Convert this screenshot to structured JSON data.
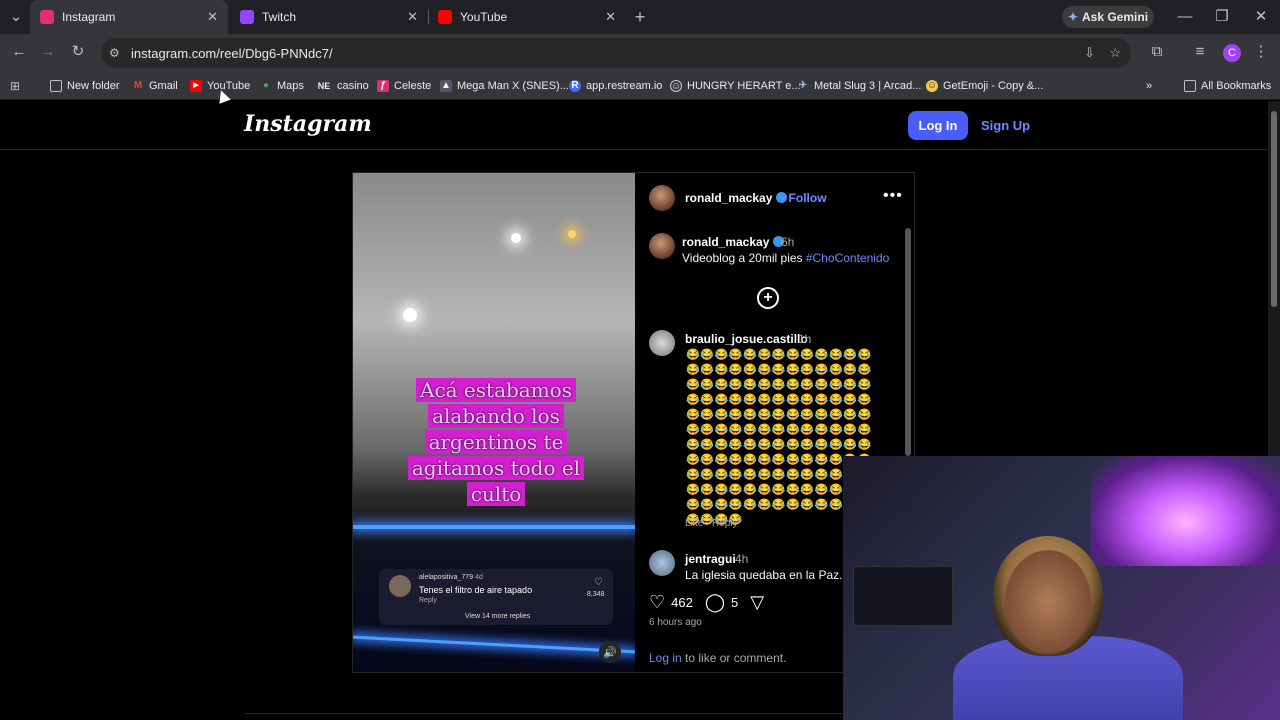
{
  "browser": {
    "tabs": [
      {
        "title": "Instagram",
        "active": true,
        "icon": "instagram-icon",
        "color": "#e1306c"
      },
      {
        "title": "Twitch",
        "active": false,
        "icon": "twitch-icon",
        "color": "#9146ff"
      },
      {
        "title": "YouTube",
        "active": false,
        "icon": "youtube-icon",
        "color": "#ff0000"
      }
    ],
    "ask_gemini": "Ask Gemini",
    "url": "instagram.com/reel/Dbg6-PNNdc7/",
    "profile_initial": "C",
    "bookmarks": [
      {
        "label": "New folder",
        "icon": "folder-icon"
      },
      {
        "label": "Gmail",
        "icon": "gmail-icon"
      },
      {
        "label": "YouTube",
        "icon": "youtube-icon"
      },
      {
        "label": "Maps",
        "icon": "maps-icon"
      },
      {
        "label": "casino",
        "icon": "NE"
      },
      {
        "label": "Celeste",
        "icon": "celeste-icon"
      },
      {
        "label": "Mega Man X (SNES)...",
        "icon": "megaman-icon"
      },
      {
        "label": "app.restream.io",
        "icon": "R"
      },
      {
        "label": "HUNGRY HERART e...",
        "icon": "hungry-icon"
      },
      {
        "label": "Metal Slug 3 | Arcad...",
        "icon": "metalslug-icon"
      },
      {
        "label": "GetEmoji - Copy &...",
        "icon": "emoji-icon"
      }
    ],
    "all_bookmarks": "All Bookmarks"
  },
  "instagram": {
    "logo": "Instagram",
    "login": "Log In",
    "signup": "Sign Up",
    "post": {
      "username": "ronald_mackay",
      "follow": "• Follow",
      "caption_time": "6h",
      "caption": "Videoblog a 20mil pies",
      "hashtag": "#ChoContenido",
      "video_caption": "Acá estabamos alabando los argentinos te agitamos todo el culto",
      "video_comment": {
        "user": "alelapositiva_779",
        "age": "4d",
        "text": "Tenes el filtro de aire tapado",
        "reply": "Reply",
        "likes": "8,348",
        "more": "View 14 more replies"
      },
      "comments": [
        {
          "user": "braulio_josue.castillo",
          "time": "1h",
          "text": "😂😂😂😂😂😂😂😂😂😂😂😂😂😂😂😂😂😂😂😂😂😂😂😂😂😂😂😂😂😂😂😂😂😂😂😂😂😂😂😂😂😂😂😂😂😂😂😂😂😂😂😂😂😂😂😂😂😂😂😂😂😂😂😂😂😂😂😂😂😂😂😂😂😂😂😂😂😂😂😂😂😂😂😂😂😂😂😂😂😂😂😂😂😂😂😂😂😂😂😂😂😂😂😂😂😂😂😂😂😂😂😂😂😂😂😂😂😂😂😂😂😂😂😂😂😂😂😂😂😂😂😂😂😂😂😂😂😂😂😂😂😂😂😂😂😂😂",
          "like": "Like",
          "reply": "Reply"
        },
        {
          "user": "jentragui",
          "time": "4h",
          "text": "La iglesia quedaba en la Paz. Bo"
        }
      ],
      "likes": "462",
      "comment_count": "5",
      "age": "6 hours ago",
      "login_prompt_link": "Log in",
      "login_prompt_rest": " to like or comment."
    }
  }
}
